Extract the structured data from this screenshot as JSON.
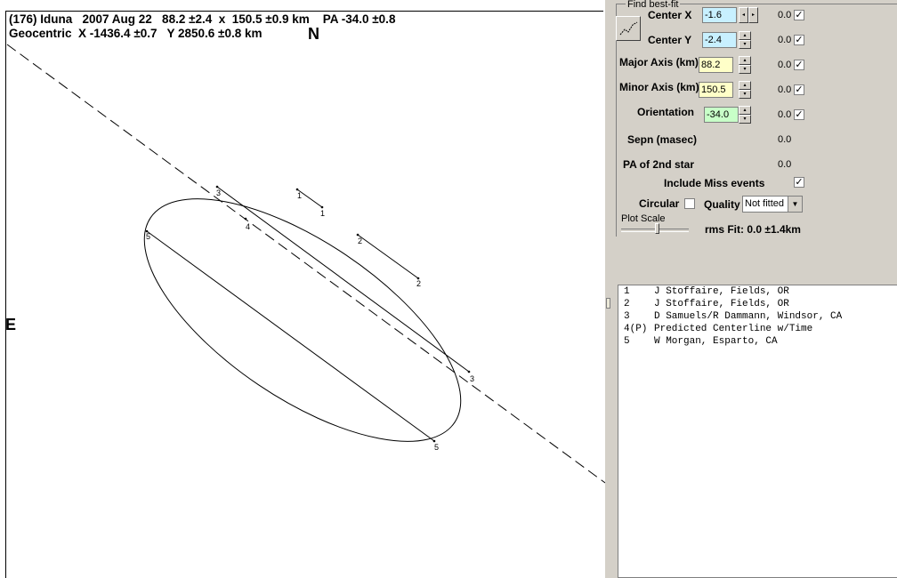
{
  "header": {
    "line1": "(176) Iduna   2007 Aug 22   88.2 ±2.4  x  150.5 ±0.9 km    PA -34.0 ±0.8",
    "line2": "Geocentric  X -1436.4 ±0.7   Y 2850.6 ±0.8 km"
  },
  "plot": {
    "north_label": "N",
    "east_label": "E",
    "chord_labels": {
      "c1_start": "1",
      "c1_end": "1",
      "c2_start": "2",
      "c2_end": "2",
      "c3_start": "3",
      "c3_end": "3",
      "c4": "4",
      "c5_start": "5",
      "c5_end": "5"
    }
  },
  "panel": {
    "group_title": "Find best-fit",
    "center_x": {
      "label": "Center X",
      "value": "-1.6",
      "uncert": "0.0",
      "checked": "✓",
      "color": "#c8f0ff"
    },
    "center_y": {
      "label": "Center Y",
      "value": "-2.4",
      "uncert": "0.0",
      "checked": "✓",
      "color": "#c8f0ff"
    },
    "major_axis": {
      "label": "Major Axis (km)",
      "value": "88.2",
      "uncert": "0.0",
      "checked": "✓",
      "color": "#ffffc8"
    },
    "minor_axis": {
      "label": "Minor Axis (km)",
      "value": "150.5",
      "uncert": "0.0",
      "checked": "✓",
      "color": "#ffffc8"
    },
    "orientation": {
      "label": "Orientation",
      "value": "-34.0",
      "uncert": "0.0",
      "checked": "✓",
      "color": "#c8ffc8"
    },
    "sepn": {
      "label": "Sepn (masec)",
      "value": "0.0"
    },
    "pa2": {
      "label": "PA of 2nd star",
      "value": "0.0"
    },
    "include_miss": {
      "label": "Include Miss events",
      "checked": "✓"
    },
    "circular": {
      "label": "Circular",
      "checked": ""
    },
    "quality": {
      "label": "Quality",
      "selected": "Not fitted"
    },
    "plot_scale": {
      "label": "Plot Scale"
    },
    "rms_fit": "rms Fit: 0.0 ±1.4km"
  },
  "observers": [
    {
      "id": "1",
      "name": "J Stoffaire, Fields, OR"
    },
    {
      "id": "2",
      "name": "J Stoffaire, Fields, OR"
    },
    {
      "id": "3",
      "name": "D Samuels/R Dammann, Windsor, CA"
    },
    {
      "id": "4(P)",
      "name": "Predicted Centerline w/Time"
    },
    {
      "id": "5",
      "name": "W Morgan, Esparto, CA"
    }
  ]
}
